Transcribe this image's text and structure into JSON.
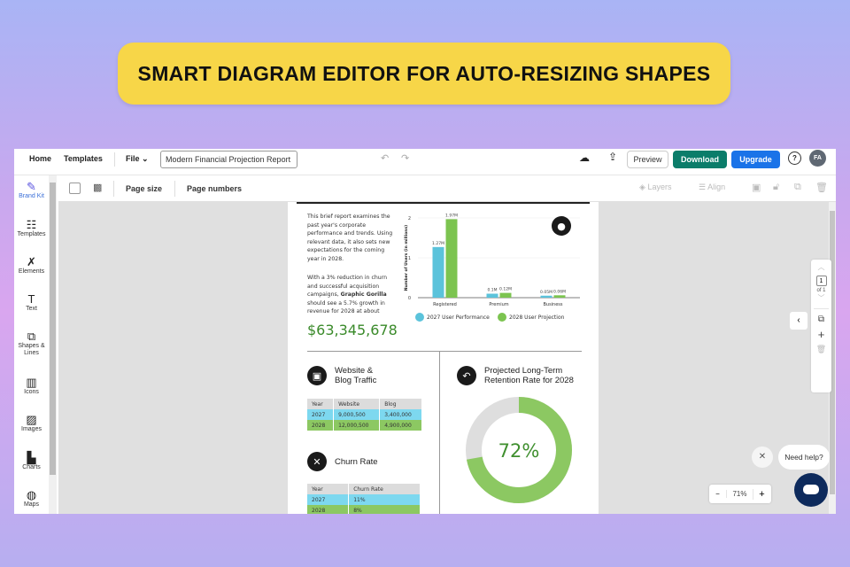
{
  "banner": {
    "title": "SMART DIAGRAM EDITOR FOR AUTO-RESIZING SHAPES"
  },
  "topbar": {
    "home": "Home",
    "templates": "Templates",
    "file": "File",
    "doc_title": "Modern Financial Projection Report",
    "preview": "Preview",
    "download": "Download",
    "upgrade": "Upgrade",
    "help": "?",
    "avatar": "FA"
  },
  "colors": {
    "download": "#0b7d6a",
    "upgrade": "#1a73e8",
    "green": "#8cc862",
    "blue": "#5bc3db"
  },
  "toolbar": {
    "page_size": "Page size",
    "page_numbers": "Page numbers",
    "layers": "Layers",
    "align": "Align"
  },
  "sidebar": {
    "items": [
      {
        "label": "Brand Kit",
        "icon": "magic-wand-icon"
      },
      {
        "label": "Templates",
        "icon": "templates-icon"
      },
      {
        "label": "Elements",
        "icon": "elements-icon"
      },
      {
        "label": "Text",
        "icon": "text-icon"
      },
      {
        "label": "Shapes &",
        "label2": "Lines",
        "icon": "shapes-icon"
      },
      {
        "label": "Icons",
        "icon": "briefcase-icon"
      },
      {
        "label": "Images",
        "icon": "image-icon"
      },
      {
        "label": "Charts",
        "icon": "chart-icon"
      },
      {
        "label": "Maps",
        "icon": "globe-icon"
      }
    ]
  },
  "page": {
    "intro": "This brief report examines the past year's corporate performance and trends. Using relevant data, it also sets new expectations for the coming year in 2028.",
    "para2_a": "With a 3% reduction in churn and successful acquisition campaigns, ",
    "para2_b": "Graphic Gorilla",
    "para2_c": " should see a 5.7% growth in revenue for 2028 at about",
    "revenue": "$63,345,678",
    "traffic_title_1": "Website &",
    "traffic_title_2": "Blog Traffic",
    "traffic_table": {
      "headers": [
        "Year",
        "Website",
        "Blog"
      ],
      "rows": [
        [
          "2027",
          "9,000,500",
          "3,400,000"
        ],
        [
          "2028",
          "12,000,500",
          "4,900,000"
        ]
      ]
    },
    "churn_title": "Churn Rate",
    "churn_table": {
      "headers": [
        "Year",
        "Churn Rate"
      ],
      "rows": [
        [
          "2027",
          "11%"
        ],
        [
          "2028",
          "8%"
        ]
      ]
    },
    "retention_title_1": "Projected Long-Term",
    "retention_title_2": "Retention Rate for 2028",
    "retention_value": "72%",
    "retention_fraction": 0.72
  },
  "chart_data": {
    "type": "bar",
    "categories": [
      "Registered",
      "Premium",
      "Business"
    ],
    "ylabel": "Number of Users (in millions)",
    "ylim": [
      0,
      2
    ],
    "yticks": [
      "0",
      "1",
      "2"
    ],
    "series": [
      {
        "name": "2027 User Performance",
        "values": [
          1.27,
          0.1,
          0.05
        ],
        "labels": [
          "1.27M",
          "0.1M",
          "0.05M"
        ]
      },
      {
        "name": "2028 User Projection",
        "values": [
          1.97,
          0.12,
          0.06
        ],
        "labels": [
          "1.97M",
          "0.12M",
          "0.06M"
        ]
      }
    ]
  },
  "pager": {
    "current": "1",
    "of": "of 1"
  },
  "zoom": {
    "minus": "−",
    "value": "71%",
    "plus": "+"
  },
  "help": {
    "text": "Need help?"
  }
}
